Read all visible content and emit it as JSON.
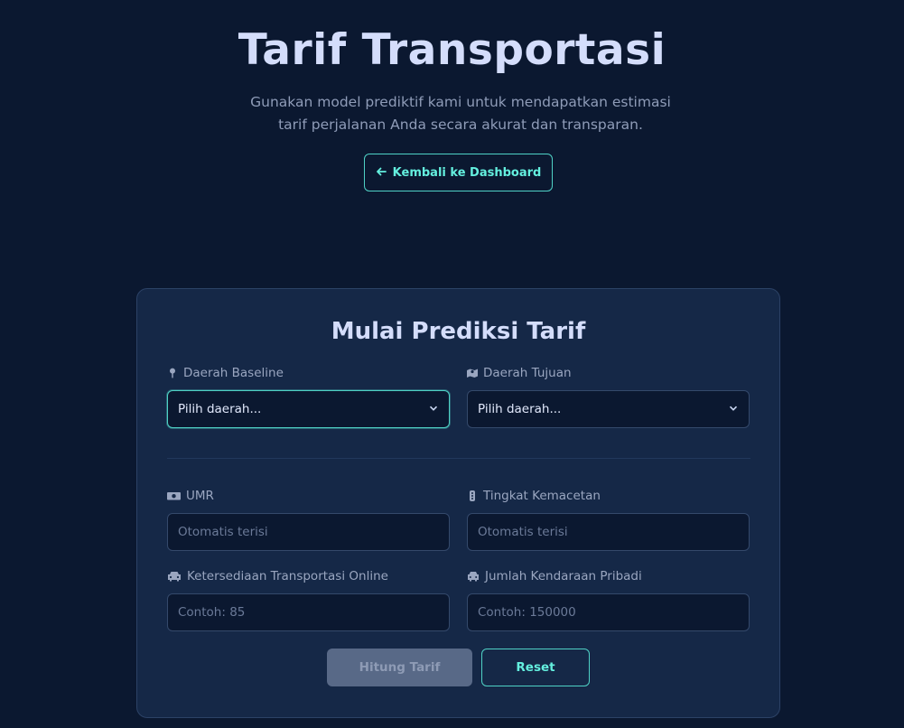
{
  "header": {
    "title": "Tarif Transportasi",
    "subtitle_line1": "Gunakan model prediktif kami untuk mendapatkan estimasi",
    "subtitle_line2": "tarif perjalanan Anda secara akurat dan transparan.",
    "back_label": "Kembali ke Dashboard",
    "back_icon": "arrow-left-icon"
  },
  "form": {
    "title": "Mulai Prediksi Tarif",
    "baseline": {
      "label": "Daerah Baseline",
      "icon": "map-pin-icon",
      "value": "Pilih daerah..."
    },
    "tujuan": {
      "label": "Daerah Tujuan",
      "icon": "map-icon",
      "value": "Pilih daerah..."
    },
    "umr": {
      "label": "UMR",
      "icon": "money-icon",
      "placeholder": "Otomatis terisi"
    },
    "kemacetan": {
      "label": "Tingkat Kemacetan",
      "icon": "traffic-light-icon",
      "placeholder": "Otomatis terisi"
    },
    "online": {
      "label": "Ketersediaan Transportasi Online",
      "icon": "taxi-icon",
      "placeholder": "Contoh: 85"
    },
    "pribadi": {
      "label": "Jumlah Kendaraan Pribadi",
      "icon": "car-icon",
      "placeholder": "Contoh: 150000"
    },
    "submit_label": "Hitung Tarif",
    "reset_label": "Reset"
  },
  "colors": {
    "background": "#0b1830",
    "card": "#152847",
    "accent": "#4fd1c5",
    "title": "#d4ddfb"
  }
}
